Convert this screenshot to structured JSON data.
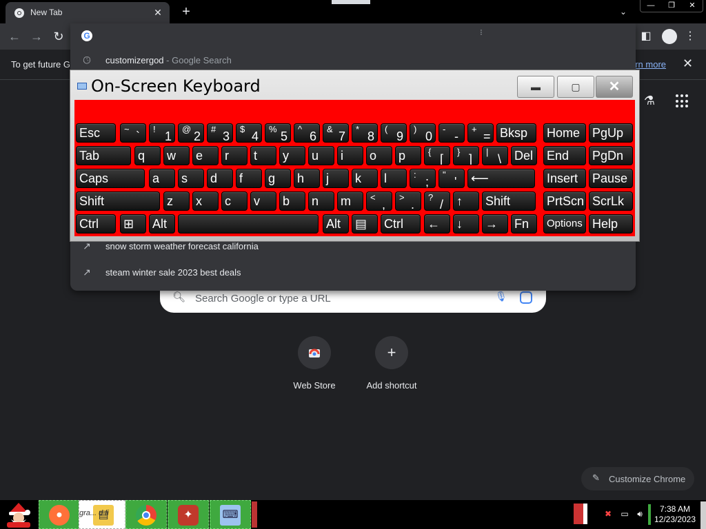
{
  "browser": {
    "tab_title": "New Tab",
    "tab_close_icon": "close-icon",
    "new_tab_icon": "plus-icon",
    "window_controls": [
      "minimize-icon",
      "restore-icon",
      "close-icon"
    ]
  },
  "toolbar": {
    "back_icon": "arrow-left-icon",
    "forward_icon": "arrow-right-icon",
    "reload_icon": "reload-icon",
    "address_value": ""
  },
  "infobar": {
    "text": "To get future G",
    "link_text": "arn more",
    "close_icon": "close-icon"
  },
  "omnibox": {
    "suggestions": [
      {
        "icon": "history-icon",
        "text": "customizergod",
        "sub": " - Google Search"
      },
      {
        "icon": "trending-icon",
        "text": "snow storm weather forecast california",
        "sub": ""
      },
      {
        "icon": "trending-icon",
        "text": "steam winter sale 2023 best deals",
        "sub": ""
      }
    ]
  },
  "ntp": {
    "search_placeholder": "Search Google or type a URL",
    "shortcuts": [
      {
        "label": "Web Store",
        "icon": "web-store-icon"
      },
      {
        "label": "Add shortcut",
        "icon": "plus-icon"
      }
    ],
    "customize_label": "Customize Chrome"
  },
  "osk": {
    "title": "On-Screen Keyboard",
    "colors": {
      "background": "#ff0000",
      "key": "#1e1e1e",
      "key_text": "#ffffff"
    },
    "rows": [
      [
        {
          "label": "Esc"
        },
        {
          "up": "~",
          "dn": "`"
        },
        {
          "up": "!",
          "dn": "1"
        },
        {
          "up": "@",
          "dn": "2"
        },
        {
          "up": "#",
          "dn": "3"
        },
        {
          "up": "$",
          "dn": "4"
        },
        {
          "up": "%",
          "dn": "5"
        },
        {
          "up": "^",
          "dn": "6"
        },
        {
          "up": "&",
          "dn": "7"
        },
        {
          "up": "*",
          "dn": "8"
        },
        {
          "up": "(",
          "dn": "9"
        },
        {
          "up": ")",
          "dn": "0"
        },
        {
          "up": "-",
          "dn": "-"
        },
        {
          "up": "+",
          "dn": "="
        },
        {
          "label": "Bksp"
        },
        {
          "label": "Home"
        },
        {
          "label": "PgUp"
        }
      ],
      [
        {
          "label": "Tab"
        },
        {
          "label": "q"
        },
        {
          "label": "w"
        },
        {
          "label": "e"
        },
        {
          "label": "r"
        },
        {
          "label": "t"
        },
        {
          "label": "y"
        },
        {
          "label": "u"
        },
        {
          "label": "i"
        },
        {
          "label": "o"
        },
        {
          "label": "p"
        },
        {
          "up": "{",
          "dn": "["
        },
        {
          "up": "}",
          "dn": "]"
        },
        {
          "up": "|",
          "dn": "\\"
        },
        {
          "label": "Del"
        },
        {
          "label": "End"
        },
        {
          "label": "PgDn"
        }
      ],
      [
        {
          "label": "Caps"
        },
        {
          "label": "a"
        },
        {
          "label": "s"
        },
        {
          "label": "d"
        },
        {
          "label": "f"
        },
        {
          "label": "g"
        },
        {
          "label": "h"
        },
        {
          "label": "j"
        },
        {
          "label": "k"
        },
        {
          "label": "l"
        },
        {
          "up": ":",
          "dn": ";"
        },
        {
          "up": "\"",
          "dn": "'"
        },
        {
          "label": "⟵"
        },
        {
          "label": "Insert"
        },
        {
          "label": "Pause"
        }
      ],
      [
        {
          "label": "Shift"
        },
        {
          "label": "z"
        },
        {
          "label": "x"
        },
        {
          "label": "c"
        },
        {
          "label": "v"
        },
        {
          "label": "b"
        },
        {
          "label": "n"
        },
        {
          "label": "m"
        },
        {
          "up": "<",
          "dn": ","
        },
        {
          "up": ">",
          "dn": "."
        },
        {
          "up": "?",
          "dn": "/"
        },
        {
          "label": "↑"
        },
        {
          "label": "Shift"
        },
        {
          "label": "PrtScn"
        },
        {
          "label": "ScrLk"
        }
      ],
      [
        {
          "label": "Ctrl"
        },
        {
          "label": "⊞"
        },
        {
          "label": "Alt"
        },
        {
          "label": ""
        },
        {
          "label": "Alt"
        },
        {
          "label": "▤"
        },
        {
          "label": "Ctrl"
        },
        {
          "label": "←"
        },
        {
          "label": "↓"
        },
        {
          "label": "→"
        },
        {
          "label": "Fn"
        },
        {
          "label": "Options"
        },
        {
          "label": "Help"
        }
      ]
    ]
  },
  "taskbar": {
    "items": [
      {
        "name": "firefox",
        "icon": "firefox-icon"
      },
      {
        "name": "file-explorer",
        "icon": "folder-icon",
        "text": "gra... d fi"
      },
      {
        "name": "chrome",
        "icon": "chrome-icon"
      },
      {
        "name": "app",
        "icon": "app-icon"
      },
      {
        "name": "osk",
        "icon": "keyboard-icon"
      }
    ],
    "clock_time": "7:38 AM",
    "clock_date": "12/23/2023"
  }
}
